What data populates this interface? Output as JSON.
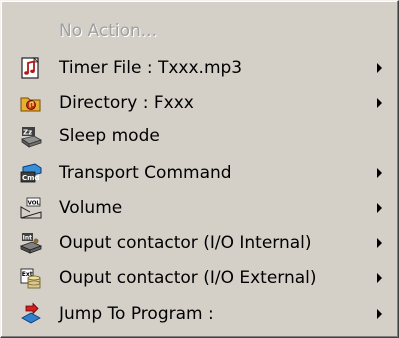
{
  "menu": {
    "items": [
      {
        "label": "No Action...",
        "icon": "none",
        "disabled": true,
        "submenu": false
      },
      {
        "label": "Timer File : Txxx.mp3",
        "icon": "music-file-icon",
        "disabled": false,
        "submenu": true
      },
      {
        "label": "Directory : Fxxx",
        "icon": "directory-icon",
        "disabled": false,
        "submenu": true
      },
      {
        "label": "Sleep mode",
        "icon": "sleep-icon",
        "disabled": false,
        "submenu": false
      },
      {
        "label": "Transport Command",
        "icon": "cmd-icon",
        "disabled": false,
        "submenu": true
      },
      {
        "label": "Volume",
        "icon": "volume-icon",
        "disabled": false,
        "submenu": true
      },
      {
        "label": "Ouput contactor (I/O Internal)",
        "icon": "io-internal-icon",
        "disabled": false,
        "submenu": true
      },
      {
        "label": "Ouput contactor (I/O External)",
        "icon": "io-external-icon",
        "disabled": false,
        "submenu": true
      },
      {
        "label": "Jump To Program :",
        "icon": "jump-icon",
        "disabled": false,
        "submenu": true
      }
    ],
    "colors": {
      "background": "#d4d0c8",
      "disabled_text": "#a0a0a0"
    }
  }
}
